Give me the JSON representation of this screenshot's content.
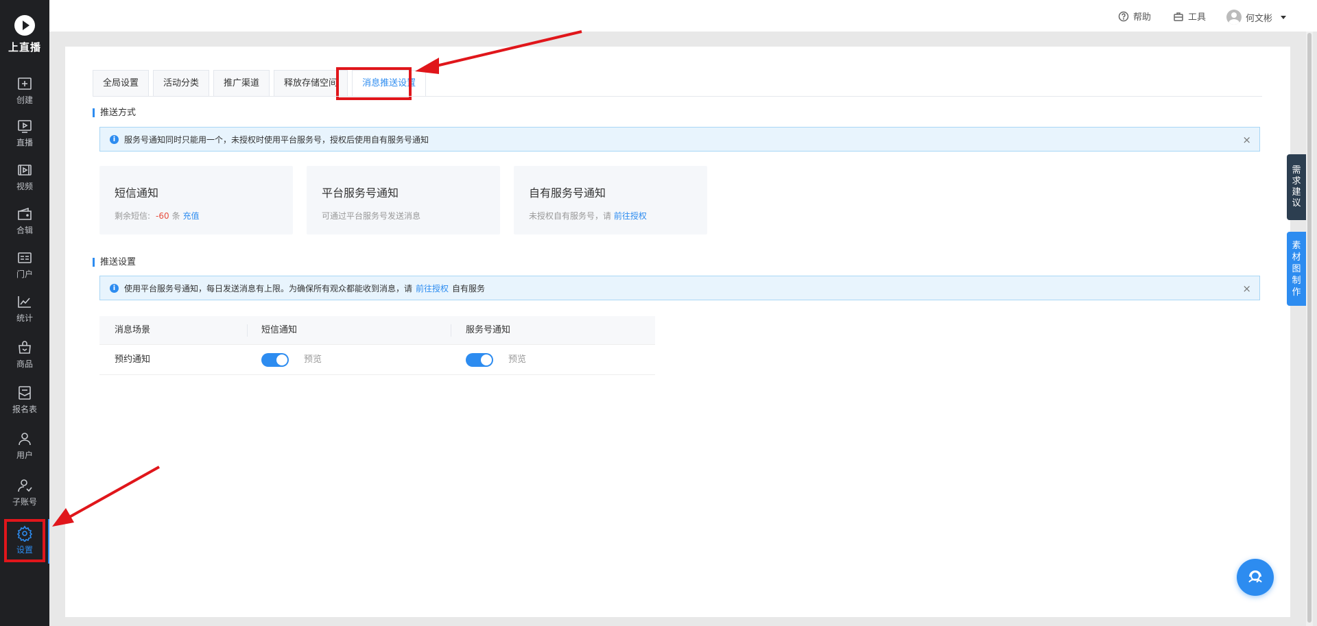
{
  "brand": {
    "name": "上直播"
  },
  "sidebar": {
    "items": [
      {
        "label": "创建",
        "icon": "plus-square-icon"
      },
      {
        "label": "直播",
        "icon": "live-play-icon"
      },
      {
        "label": "视频",
        "icon": "video-icon"
      },
      {
        "label": "合辑",
        "icon": "wallet-icon"
      },
      {
        "label": "门户",
        "icon": "portal-icon"
      },
      {
        "label": "统计",
        "icon": "chart-line-icon"
      },
      {
        "label": "商品",
        "icon": "shopping-bag-icon"
      },
      {
        "label": "报名表",
        "icon": "form-icon"
      },
      {
        "label": "用户",
        "icon": "user-icon"
      },
      {
        "label": "子账号",
        "icon": "sub-account-icon"
      },
      {
        "label": "设置",
        "icon": "gear-icon",
        "active": true
      }
    ]
  },
  "topbar": {
    "help": "帮助",
    "tools": "工具",
    "user": "何文彬"
  },
  "tabs": [
    {
      "label": "全局设置"
    },
    {
      "label": "活动分类"
    },
    {
      "label": "推广渠道"
    },
    {
      "label": "释放存储空间"
    },
    {
      "label": "消息推送设置",
      "active": true
    }
  ],
  "push_method": {
    "title": "推送方式",
    "notice": "服务号通知同时只能用一个，未授权时使用平台服务号，授权后使用自有服务号通知",
    "cards": {
      "sms": {
        "title": "短信通知",
        "desc_prefix": "剩余短信:",
        "count": "-60",
        "unit": "条",
        "action": "充值"
      },
      "platform": {
        "title": "平台服务号通知",
        "desc": "可通过平台服务号发送消息"
      },
      "own": {
        "title": "自有服务号通知",
        "desc_prefix": "未授权自有服务号，请",
        "action": "前往授权"
      }
    }
  },
  "push_settings": {
    "title": "推送设置",
    "notice_prefix": "使用平台服务号通知，每日发送消息有上限。为确保所有观众都能收到消息，请",
    "notice_link": "前往授权",
    "notice_suffix": "自有服务",
    "table": {
      "headers": [
        "消息场景",
        "短信通知",
        "服务号通知"
      ],
      "rows": [
        {
          "scene": "预约通知",
          "sms_on": true,
          "sms_preview": "预览",
          "service_on": true,
          "service_preview": "预览"
        }
      ]
    }
  },
  "floating": {
    "feedback": "需求建议",
    "material": "素材图制作"
  },
  "colors": {
    "accent": "#2d8cf0",
    "sidebar_bg": "#1f2023",
    "highlight_red": "#e0161b",
    "negative": "#e74c3c"
  }
}
